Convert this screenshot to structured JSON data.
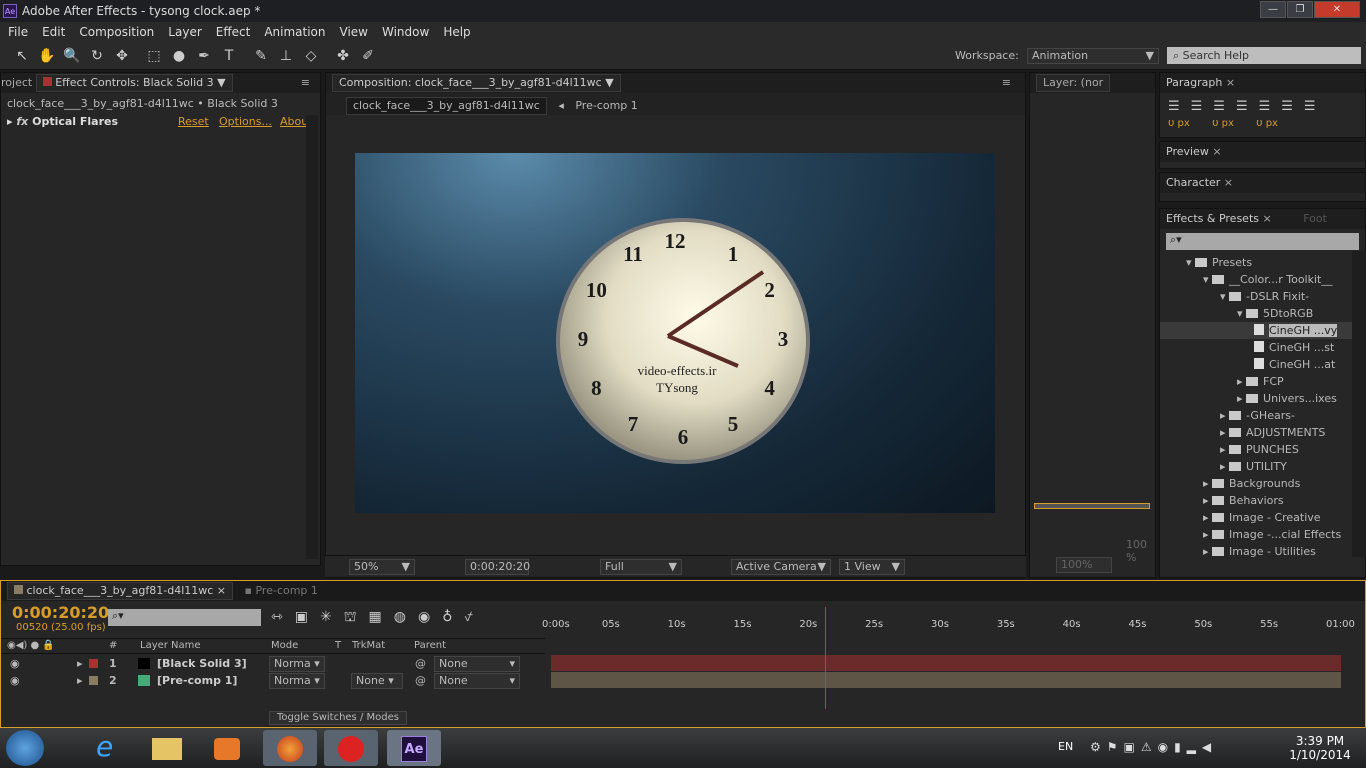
{
  "window": {
    "title": "Adobe After Effects - tysong clock.aep *",
    "app_icon": "Ae"
  },
  "menu": [
    "File",
    "Edit",
    "Composition",
    "Layer",
    "Effect",
    "Animation",
    "View",
    "Window",
    "Help"
  ],
  "workspace": {
    "label": "Workspace:",
    "value": "Animation"
  },
  "search_help": {
    "placeholder": "Search Help"
  },
  "effect_controls": {
    "tab_project": "roject",
    "tab": "Effect Controls: Black Solid 3",
    "breadcrumb": "clock_face___3_by_agf81-d4l11wc • Black Solid 3",
    "effect": "Optical Flares",
    "reset": "Reset",
    "options": "Options...",
    "about": "Abou"
  },
  "composition": {
    "tab": "Composition: clock_face___3_by_agf81-d4l11wc",
    "crumb1": "clock_face___3_by_agf81-d4l11wc",
    "crumb2": "Pre-comp 1",
    "watermark1": "video-effects.ir",
    "watermark2": "TYsong",
    "clock_numbers": [
      "12",
      "1",
      "2",
      "3",
      "4",
      "5",
      "6",
      "7",
      "8",
      "9",
      "10",
      "11"
    ],
    "footer": {
      "zoom": "50%",
      "timecode": "0:00:20:20",
      "resolution": "Full",
      "camera": "Active Camera",
      "view": "1 View"
    }
  },
  "layer_panel": {
    "tab": "Layer: (nor",
    "zoom": "100%",
    "fit": "100 %"
  },
  "paragraph": {
    "tab": "Paragraph",
    "indent1": "0 px",
    "indent2": "0 px",
    "indent3": "0 px"
  },
  "preview": {
    "tab": "Preview"
  },
  "character": {
    "tab": "Character"
  },
  "effects_presets": {
    "tab": "Effects & Presets",
    "tab2": "Foot",
    "tree": [
      {
        "label": "Presets",
        "depth": 0,
        "open": true
      },
      {
        "label": "__Color...r Toolkit__",
        "depth": 1,
        "open": true
      },
      {
        "label": "-DSLR Fixit-",
        "depth": 2,
        "open": true
      },
      {
        "label": "5DtoRGB",
        "depth": 3,
        "open": true
      },
      {
        "label": "CineGH ...vy",
        "depth": 4,
        "file": true,
        "selected": true
      },
      {
        "label": "CineGH ...st",
        "depth": 4,
        "file": true
      },
      {
        "label": "CineGH ...at",
        "depth": 4,
        "file": true
      },
      {
        "label": "FCP",
        "depth": 3
      },
      {
        "label": "Univers...ixes",
        "depth": 3
      },
      {
        "label": "-GHears-",
        "depth": 2
      },
      {
        "label": "ADJUSTMENTS",
        "depth": 2
      },
      {
        "label": "PUNCHES",
        "depth": 2
      },
      {
        "label": "UTILITY",
        "depth": 2
      },
      {
        "label": "Backgrounds",
        "depth": 1
      },
      {
        "label": "Behaviors",
        "depth": 1
      },
      {
        "label": "Image - Creative",
        "depth": 1
      },
      {
        "label": "Image -...cial Effects",
        "depth": 1
      },
      {
        "label": "Image - Utilities",
        "depth": 1
      }
    ]
  },
  "timeline": {
    "tab1": "clock_face___3_by_agf81-d4l11wc",
    "tab2": "Pre-comp 1",
    "timecode": "0:00:20:20",
    "frames": "00520 (25.00 fps)",
    "columns": {
      "num": "#",
      "name": "Layer Name",
      "mode": "Mode",
      "t": "T",
      "trkmat": "TrkMat",
      "parent": "Parent"
    },
    "layers": [
      {
        "num": "1",
        "name": "[Black Solid 3]",
        "mode": "Norma",
        "trkmat": "",
        "parent": "None",
        "color": "#a83232",
        "bar": "#6b2b2b"
      },
      {
        "num": "2",
        "name": "[Pre-comp 1]",
        "mode": "Norma",
        "trkmat": "None",
        "parent": "None",
        "color": "#8a7b63",
        "bar": "#5e5547"
      }
    ],
    "ruler": [
      "0:00s",
      "05s",
      "10s",
      "15s",
      "20s",
      "25s",
      "30s",
      "35s",
      "40s",
      "45s",
      "50s",
      "55s",
      "01:00"
    ],
    "current_time_s": 20.8,
    "toggle": "Toggle Switches / Modes"
  },
  "tray": {
    "lang": "EN",
    "time": "3:39 PM",
    "date": "1/10/2014"
  }
}
